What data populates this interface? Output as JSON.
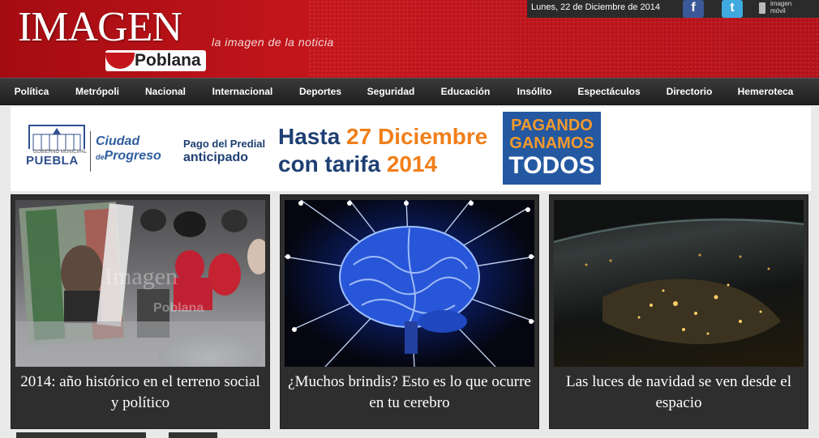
{
  "header": {
    "logo_main": "IMAGEN",
    "logo_sub": "Poblana",
    "tagline": "la imagen de la noticia",
    "date": "Lunes, 22 de Diciembre de 2014",
    "social": [
      {
        "name": "facebook",
        "icon": "facebook-icon",
        "glyph": "f"
      },
      {
        "name": "twitter",
        "icon": "twitter-icon",
        "glyph": "t"
      }
    ],
    "mobile_label_1": "imagen",
    "mobile_label_2": "móvil",
    "colors": {
      "brand_red": "#c4161c",
      "dark_bar": "#2b2b2b"
    }
  },
  "nav": {
    "items": [
      "Política",
      "Metrópoli",
      "Nacional",
      "Internacional",
      "Deportes",
      "Seguridad",
      "Educación",
      "Insólito",
      "Espectáculos",
      "Directorio",
      "Hemeroteca"
    ]
  },
  "banner": {
    "gov_small": "GOBIERNO MUNICIPAL",
    "gov_name": "PUEBLA",
    "ciudad_1": "Ciudad",
    "ciudad_2a": "de",
    "ciudad_2b": "Progreso",
    "pago_1": "Pago del Predial",
    "pago_2": "anticipado",
    "hasta_1a": "Hasta",
    "hasta_1b": "27 Diciembre",
    "hasta_2a": "con tarifa",
    "hasta_2b": "2014",
    "slogan_1": "PAGANDO",
    "slogan_2": "GANAMOS",
    "slogan_3": "TODOS",
    "colors": {
      "navy": "#1e3f73",
      "orange": "#f07f19",
      "slogan_bg": "#2458a1"
    }
  },
  "articles": [
    {
      "caption": "2014: año histórico en el terreno social y político",
      "photo": "protest-photo",
      "watermark_1": "Imagen",
      "watermark_2": "Poblana"
    },
    {
      "caption": "¿Muchos brindis? Esto es lo que ocurre en tu cerebro",
      "photo": "brain-photo"
    },
    {
      "caption": "Las luces de navidad se ven desde el espacio",
      "photo": "earth-night-photo"
    }
  ]
}
